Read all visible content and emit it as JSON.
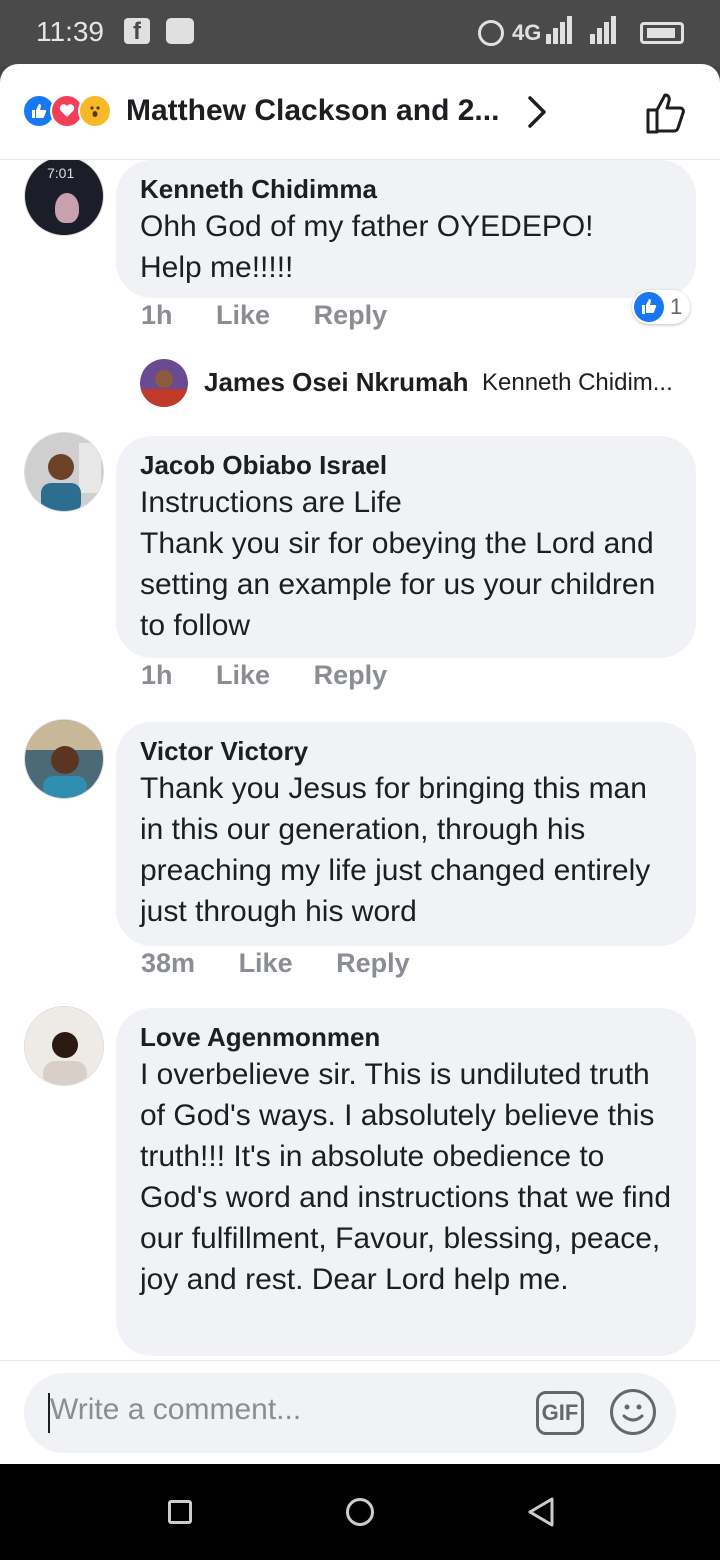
{
  "status": {
    "time": "11:39",
    "network": "4G"
  },
  "header": {
    "title": "Matthew Clackson and 2..."
  },
  "comments": [
    {
      "author": "Kenneth Chidimma",
      "text": "Ohh God of my father OYEDEPO!\nHelp me!!!!!",
      "time": "1h",
      "like": "Like",
      "reply": "Reply",
      "reactions": "1",
      "avatar_label": "7:01"
    },
    {
      "author": "Jacob Obiabo Israel",
      "text": "Instructions are Life\nThank you sir for obeying the Lord and setting an example for us your children to follow",
      "time": "1h",
      "like": "Like",
      "reply": "Reply"
    },
    {
      "author": "Victor Victory",
      "text": "Thank you Jesus for bringing this man in this our generation, through his preaching my life just changed entirely just through his word",
      "time": "38m",
      "like": "Like",
      "reply": "Reply"
    },
    {
      "author": "Love Agenmonmen",
      "text": "I overbelieve sir. This is undiluted truth of God's ways. I absolutely believe this truth!!! It's in absolute obedience to God's word and instructions that we find our fulfillment, Favour, blessing, peace, joy and rest. Dear Lord help me."
    }
  ],
  "reply_preview": {
    "name": "James Osei Nkrumah",
    "snippet": "Kenneth Chidim..."
  },
  "composer": {
    "placeholder": "Write a comment...",
    "gif_label": "GIF"
  },
  "colors": {
    "brand": "#1877f2",
    "love": "#f33e58",
    "wow": "#f7b928",
    "bubble": "#f0f2f5",
    "meta": "#8a8d91"
  },
  "icons": [
    "facebook-icon",
    "gamepad-icon",
    "alarm-icon",
    "signal-icon",
    "battery-icon",
    "like-reaction-icon",
    "love-reaction-icon",
    "wow-reaction-icon",
    "chevron-right-icon",
    "thumbs-up-icon",
    "gif-icon",
    "emoji-icon",
    "recents-icon",
    "home-icon",
    "back-icon"
  ]
}
